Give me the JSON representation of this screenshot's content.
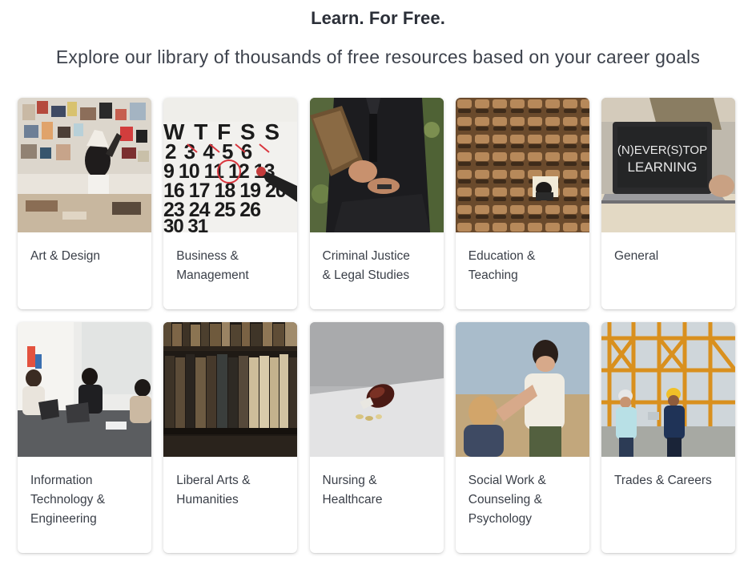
{
  "header": {
    "title": "Learn. For Free.",
    "subtitle": "Explore our library of thousands of free resources based on your career goals"
  },
  "categories": [
    {
      "label": "Art & Design",
      "image": "art-design-image"
    },
    {
      "label": "Business &\nManagement",
      "image": "calendar-image"
    },
    {
      "label": "Criminal Justice\n& Legal Studies",
      "image": "legal-professional-image"
    },
    {
      "label": "Education &\nTeaching",
      "image": "auditorium-image"
    },
    {
      "label": "General",
      "image": "laptop-image"
    },
    {
      "label": "Information\nTechnology &\nEngineering",
      "image": "team-laptops-image"
    },
    {
      "label": "Liberal Arts &\nHumanities",
      "image": "bookshelf-image"
    },
    {
      "label": "Nursing &\nHealthcare",
      "image": "medicine-bottle-image"
    },
    {
      "label": "Social Work &\nCounseling &\nPsychology",
      "image": "children-image"
    },
    {
      "label": "Trades & Careers",
      "image": "construction-site-image"
    }
  ],
  "calendar_image_text": {
    "row1": "W T F S S",
    "row2": "2 3 4 5 6",
    "row3": "9 10 11 12 13",
    "row4": "16 17 18 19 20",
    "row5": "23 24 25 26",
    "row6": "30 31"
  },
  "laptop_image_text": {
    "line1": "(N)EVER(S)TOP",
    "line2": "LEARNING"
  }
}
